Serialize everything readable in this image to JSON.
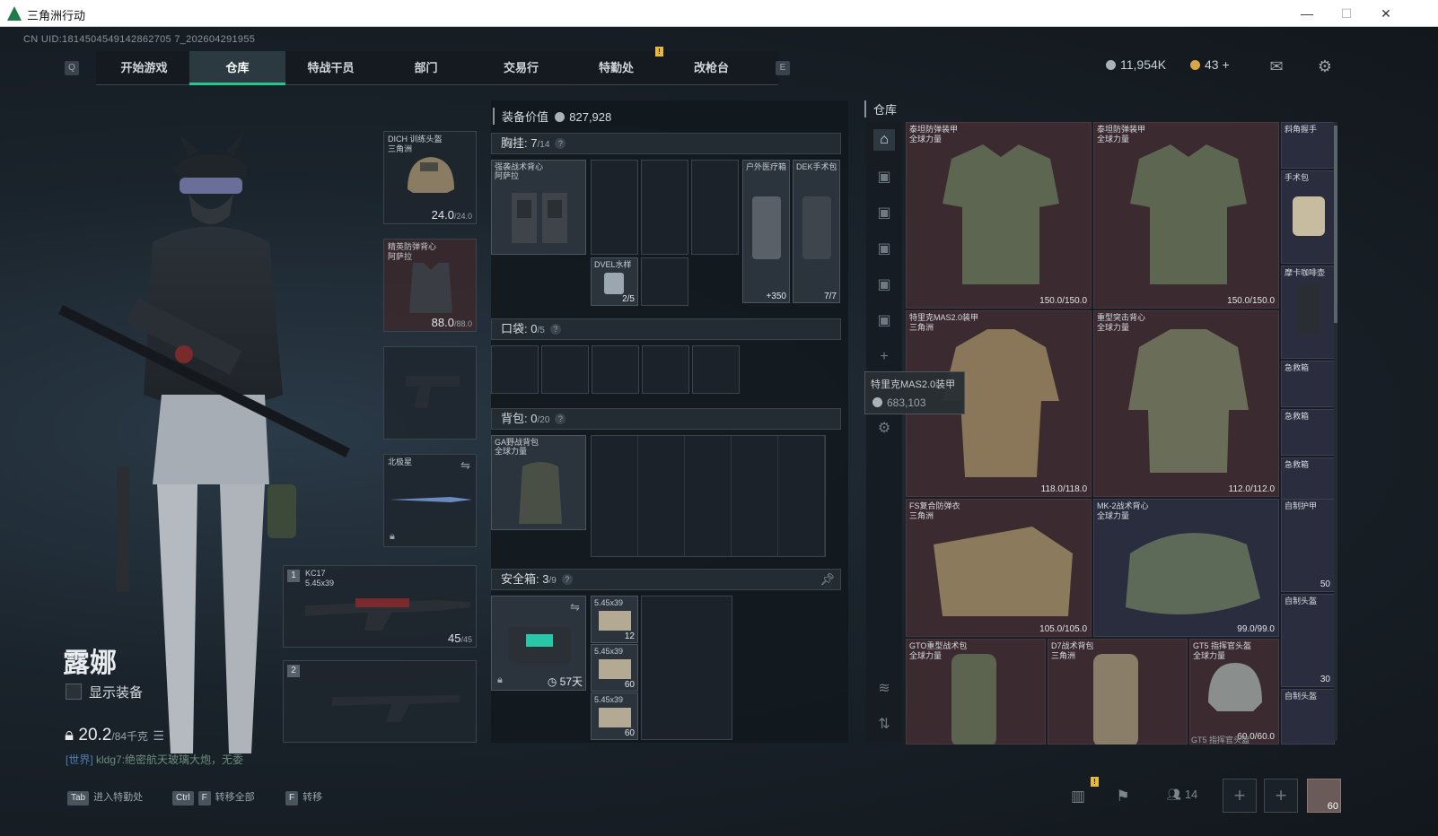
{
  "window": {
    "title": "三角洲行动",
    "minimize": "—",
    "maximize": "☐",
    "close": "✕"
  },
  "uid": "CN UID:1814504549142862705 7_202604291955",
  "nav": {
    "left_key": "Q",
    "right_key": "E",
    "tabs": [
      "开始游戏",
      "仓库",
      "特战干员",
      "部门",
      "交易行",
      "特勤处",
      "改枪台"
    ],
    "active": "仓库",
    "notice": "!"
  },
  "currency": {
    "silver": "11,954K",
    "gold": "43",
    "plus": "+"
  },
  "character": {
    "name": "露娜",
    "show_equipment": "显示装备",
    "weight": "20.2",
    "weight_max": "/84千克"
  },
  "chat": {
    "channel": "[世界]",
    "user": "kldg7:",
    "message": "绝密航天玻璃大炮，无委"
  },
  "slots": {
    "helmet": {
      "name": "DICH 训练头盔",
      "source": "三角洲",
      "durability": "24.0",
      "max": "/24.0"
    },
    "armor": {
      "name": "精英防弹背心",
      "source": "阿萨拉",
      "durability": "88.0",
      "max": "/88.0"
    },
    "melee": {
      "name": "北极星"
    },
    "primary": {
      "index": "1",
      "name": "KC17",
      "ammo": "5.45x39",
      "count": "45",
      "max": "/45"
    },
    "secondary": {
      "index": "2"
    }
  },
  "center": {
    "value_label": "装备价值",
    "value": "827,928",
    "chest_label": "胸挂:",
    "chest_count": "7",
    "chest_max": "/14",
    "chest_rig": {
      "name": "强袭战术背心",
      "source": "阿萨拉"
    },
    "chest_items": [
      {
        "name": "DVEL水样",
        "count": "2/5"
      },
      {
        "name": "户外医疗箱",
        "count": "+350"
      },
      {
        "name": "DEK手术包",
        "count": "7/7"
      }
    ],
    "pocket_label": "口袋:",
    "pocket_count": "0",
    "pocket_max": "/5",
    "bag_label": "背包:",
    "bag_count": "0",
    "bag_max": "/20",
    "bag": {
      "name": "GA野战背包",
      "source": "全球力量"
    },
    "safe_label": "安全箱:",
    "safe_count": "3",
    "safe_max": "/9",
    "safe_days": "57天",
    "safe_items": [
      {
        "name": "5.45x39",
        "count": "12"
      },
      {
        "name": "5.45x39",
        "count": "60"
      },
      {
        "name": "5.45x39",
        "count": "60"
      }
    ],
    "question": "?"
  },
  "warehouse": {
    "title": "仓库",
    "cards": [
      {
        "name": "泰坦防弹装甲",
        "source": "全球力量",
        "dur": "150.0/150.0"
      },
      {
        "name": "泰坦防弹装甲",
        "source": "全球力量",
        "dur": "150.0/150.0"
      },
      {
        "name": "特里克MAS2.0装甲",
        "source": "三角洲",
        "dur": "118.0/118.0"
      },
      {
        "name": "重型突击背心",
        "source": "全球力量",
        "dur": "112.0/112.0"
      },
      {
        "name": "FS复合防弹衣",
        "source": "三角洲",
        "dur": "105.0/105.0"
      },
      {
        "name": "MK-2战术背心",
        "source": "全球力量",
        "dur": "99.0/99.0"
      },
      {
        "name": "GTO重型战术包",
        "source": "全球力量",
        "dur": ""
      },
      {
        "name": "D7战术背包",
        "source": "三角洲",
        "dur": ""
      },
      {
        "name": "GT5 指挥官头盔",
        "source": "全球力量",
        "dur": "60.0/60.0"
      }
    ],
    "small": [
      {
        "name": "斜角握手",
        "count": ""
      },
      {
        "name": "手术包",
        "count": ""
      },
      {
        "name": "摩卡咖啡壶",
        "count": ""
      },
      {
        "name": "急救箱",
        "count": ""
      },
      {
        "name": "急救箱",
        "count": ""
      },
      {
        "name": "急救箱",
        "count": ""
      },
      {
        "name": "自制护甲",
        "count": "50"
      },
      {
        "name": "自制头盔",
        "count": "30"
      },
      {
        "name": "自制头盔",
        "count": ""
      }
    ],
    "bottom_label": "GT5 指挥官头盔",
    "tooltip": {
      "name": "特里克MAS2.0装甲",
      "price": "683,103"
    }
  },
  "bottom": {
    "b1_key": "Tab",
    "b1_label": "进入特勤处",
    "b2_key1": "Ctrl",
    "b2_key2": "F",
    "b2_label": "转移全部",
    "b3_key": "F",
    "b3_label": "转移",
    "friends": "14",
    "level": "60",
    "notice": "!"
  },
  "colors": {
    "accent": "#23c98c",
    "rare_red": "#3b2a30",
    "rare_blue": "#2a2d3e"
  }
}
